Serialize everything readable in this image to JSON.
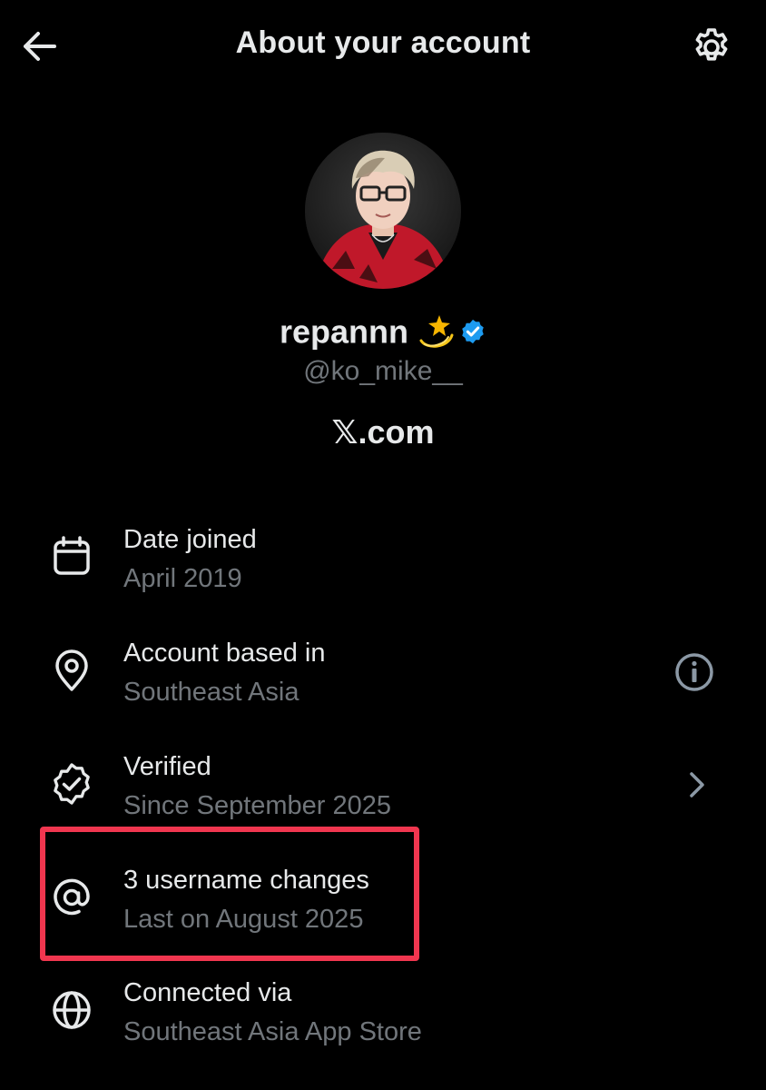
{
  "header": {
    "title": "About your account"
  },
  "profile": {
    "display_name": "repannn",
    "handle": "@ko_mike__",
    "platform": "𝕏.com",
    "verified": true
  },
  "details": {
    "date_joined": {
      "title": "Date joined",
      "value": "April 2019"
    },
    "based_in": {
      "title": "Account based in",
      "value": "Southeast Asia"
    },
    "verified": {
      "title": "Verified",
      "value": "Since September 2025"
    },
    "username_changes": {
      "title": "3 username changes",
      "value": "Last on August 2025"
    },
    "connected_via": {
      "title": "Connected via",
      "value": "Southeast Asia App Store"
    }
  },
  "colors": {
    "background": "#000000",
    "primary_text": "#e7e9ea",
    "secondary_text": "#71767b",
    "verified_blue": "#1d9bf0",
    "highlight_red": "#f0364f"
  },
  "icons": {
    "back": "arrow-left-icon",
    "settings": "gear-icon",
    "date_joined": "calendar-icon",
    "based_in": "location-pin-icon",
    "verified": "verified-badge-icon",
    "username_changes": "at-sign-icon",
    "connected_via": "globe-icon",
    "info": "info-icon",
    "chevron": "chevron-right-icon"
  }
}
